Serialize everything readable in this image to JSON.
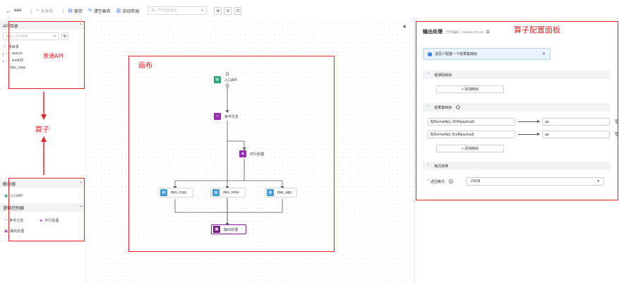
{
  "toolbar": {
    "back_icon": "arrow-left-icon",
    "title": "aaa",
    "status": "未发布",
    "save_label": "保存",
    "clear_label": "清空画布",
    "auto_layout_label": "自动布局",
    "search_placeholder": "输入节点名称查询"
  },
  "left_panel": {
    "api_section_title": "API目录",
    "search_placeholder": "请输入名称搜索",
    "tree": [
      {
        "label": "根目录",
        "expandable": false
      },
      {
        "label": "search",
        "expandable": true
      },
      {
        "label": "test420",
        "expandable": true
      },
      {
        "label": "dws_copy",
        "expandable": false
      }
    ],
    "trigger_section_title": "触发器",
    "trigger_items": [
      "入口API"
    ],
    "logic_section_title": "逻辑控制器",
    "logic_items": [
      "条件分支",
      "并行处理",
      "输出处理"
    ]
  },
  "annotations": {
    "normal_api": "普通API",
    "operators": "算子",
    "canvas": "画布",
    "config_panel": "算子配置面板"
  },
  "flow_nodes": {
    "entry": "入口API",
    "condition": "条件分支",
    "parallel": "并行处理",
    "dws_copy": "dws_copy",
    "dws_none": "dws_none",
    "dws_app": "dws_app",
    "output": "输出处理"
  },
  "right_panel": {
    "title": "输出处理",
    "subtitle": "(节点编码：Output_37125)",
    "info_text": "请至少配置一个结果集映射",
    "error_map_title": "错误码映射",
    "add_map_label": "+ 添加映射",
    "result_map_title": "结果集映射",
    "mappings": [
      {
        "source": "${NormalApi_4246|payload}",
        "target": "aa"
      },
      {
        "source": "${NormalApi_5caff|payload}",
        "target": "aa"
      }
    ],
    "format_section_title": "格式转换",
    "format_label": "返回格式",
    "format_value": "JSON"
  },
  "colors": {
    "annotation_red": "#e5222a",
    "accent_blue": "#4a6fe3",
    "node_green": "#2ca66f",
    "node_purple": "#9b2cb0",
    "node_blue": "#3f9bd9",
    "output_purple": "#7a1d8a"
  }
}
